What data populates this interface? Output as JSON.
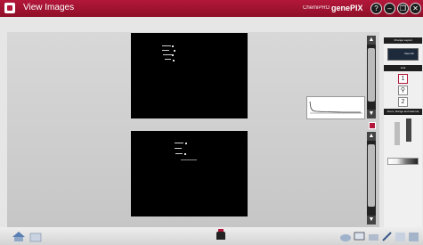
{
  "window": {
    "title": "View Images",
    "brand_small": "ChemiPRO",
    "brand_big": "genePIX",
    "controls": {
      "help": "?",
      "minimize": "–",
      "restore": "❐",
      "close": "✕"
    }
  },
  "images": [
    {
      "id": "upper-blot"
    },
    {
      "id": "lower-blot"
    }
  ],
  "panel": {
    "change_layout": "Change Layout",
    "layout_label": "View All",
    "link": "Link",
    "zoom_section": "Zoom, Range and Gamma"
  },
  "colors": {
    "accent": "#b3173a",
    "image_bg": "#000000"
  }
}
